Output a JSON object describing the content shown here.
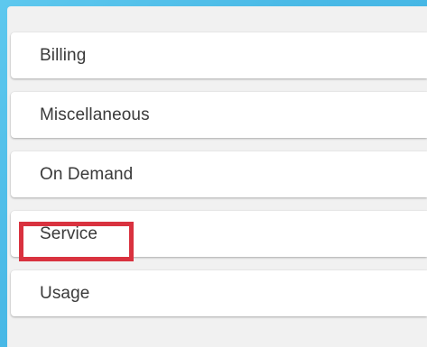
{
  "menu": {
    "items": [
      {
        "label": "Billing"
      },
      {
        "label": "Miscellaneous"
      },
      {
        "label": "On Demand"
      },
      {
        "label": "Service"
      },
      {
        "label": "Usage"
      }
    ]
  },
  "highlight": {
    "target": "Service",
    "color": "#d9323f"
  },
  "colors": {
    "background": "#49b9e6",
    "panel": "#f1f1f1",
    "card": "#ffffff",
    "text": "#3a3a3a"
  }
}
